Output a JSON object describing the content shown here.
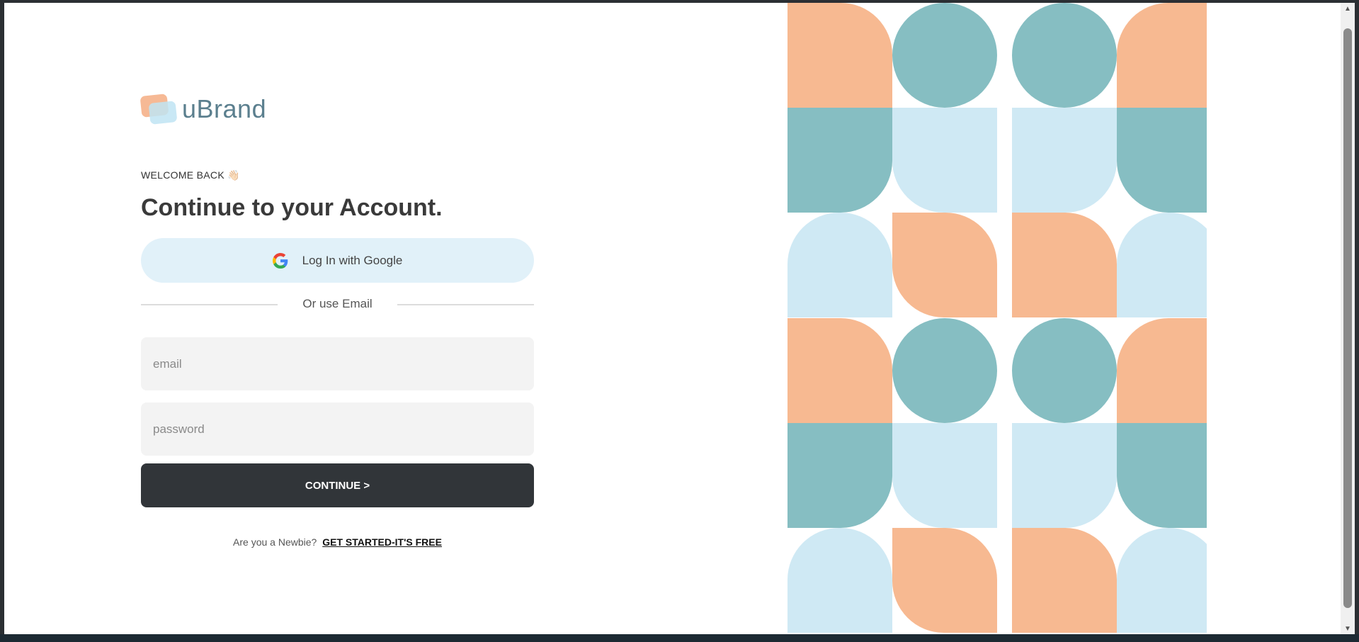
{
  "brand": {
    "name": "uBrand"
  },
  "welcome": {
    "text": "WELCOME BACK 👋🏻",
    "headline": "Continue to your Account."
  },
  "google_button": {
    "label": "Log In with Google"
  },
  "divider": {
    "label": "Or use Email"
  },
  "form": {
    "email_placeholder": "email",
    "email_value": "",
    "password_placeholder": "password",
    "password_value": "",
    "continue_label": "CONTINUE >"
  },
  "signup": {
    "prompt": "Are you a Newbie?",
    "link_label": "GET STARTED-IT'S FREE"
  },
  "colors": {
    "peach": "#f7b991",
    "teal": "#86bec2",
    "light_blue": "#cfe9f4",
    "dark_button": "#313539",
    "google_button_bg": "#e1f1f9",
    "field_bg": "#f3f3f3",
    "brand_text": "#5b7f8e"
  },
  "pattern_icons": [
    "quarter-circle-shape",
    "circle-shape",
    "rounded-square-shape"
  ]
}
